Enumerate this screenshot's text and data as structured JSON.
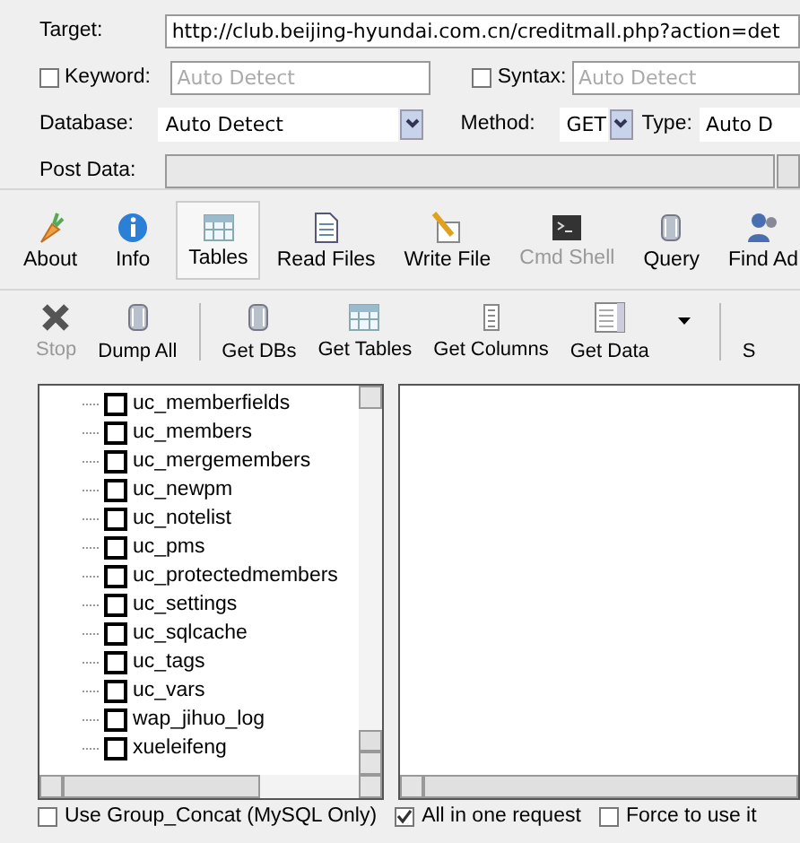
{
  "form": {
    "target": {
      "label": "Target:",
      "value": "http://club.beijing-hyundai.com.cn/creditmall.php?action=det"
    },
    "keyword": {
      "label": "Keyword:",
      "checked": false,
      "placeholder": "Auto Detect"
    },
    "syntax": {
      "label": "Syntax:",
      "checked": false,
      "placeholder": "Auto Detect"
    },
    "database": {
      "label": "Database:",
      "value": "Auto Detect"
    },
    "method": {
      "label": "Method:",
      "value": "GET"
    },
    "type": {
      "label": "Type:",
      "value": "Auto D"
    },
    "post_data": {
      "label": "Post Data:"
    }
  },
  "main_toolbar": [
    {
      "label": "About",
      "selected": false,
      "disabled": false
    },
    {
      "label": "Info",
      "selected": false,
      "disabled": false
    },
    {
      "label": "Tables",
      "selected": true,
      "disabled": false
    },
    {
      "label": "Read Files",
      "selected": false,
      "disabled": false
    },
    {
      "label": "Write File",
      "selected": false,
      "disabled": false
    },
    {
      "label": "Cmd Shell",
      "selected": false,
      "disabled": true
    },
    {
      "label": "Query",
      "selected": false,
      "disabled": false
    },
    {
      "label": "Find Ad",
      "selected": false,
      "disabled": false
    }
  ],
  "action_toolbar": [
    {
      "kind": "button",
      "label": "Stop",
      "disabled": true
    },
    {
      "kind": "button",
      "label": "Dump All",
      "disabled": false
    },
    {
      "kind": "separator"
    },
    {
      "kind": "button",
      "label": "Get DBs",
      "disabled": false
    },
    {
      "kind": "button",
      "label": "Get Tables",
      "disabled": false
    },
    {
      "kind": "button",
      "label": "Get Columns",
      "disabled": false
    },
    {
      "kind": "button",
      "label": "Get Data",
      "disabled": false
    },
    {
      "kind": "caret"
    },
    {
      "kind": "separator"
    },
    {
      "kind": "button",
      "label": "S",
      "disabled": false
    }
  ],
  "tables_tree": [
    {
      "name": "uc_memberfields",
      "checked": false
    },
    {
      "name": "uc_members",
      "checked": false
    },
    {
      "name": "uc_mergemembers",
      "checked": false
    },
    {
      "name": "uc_newpm",
      "checked": false
    },
    {
      "name": "uc_notelist",
      "checked": false
    },
    {
      "name": "uc_pms",
      "checked": false
    },
    {
      "name": "uc_protectedmembers",
      "checked": false
    },
    {
      "name": "uc_settings",
      "checked": false
    },
    {
      "name": "uc_sqlcache",
      "checked": false
    },
    {
      "name": "uc_tags",
      "checked": false
    },
    {
      "name": "uc_vars",
      "checked": false
    },
    {
      "name": "wap_jihuo_log",
      "checked": false
    },
    {
      "name": "xueleifeng",
      "checked": false
    }
  ],
  "options": [
    {
      "label": "Use Group_Concat (MySQL Only)",
      "checked": false
    },
    {
      "label": "All in one request",
      "checked": true
    },
    {
      "label": "Force to use it",
      "checked": false
    }
  ]
}
